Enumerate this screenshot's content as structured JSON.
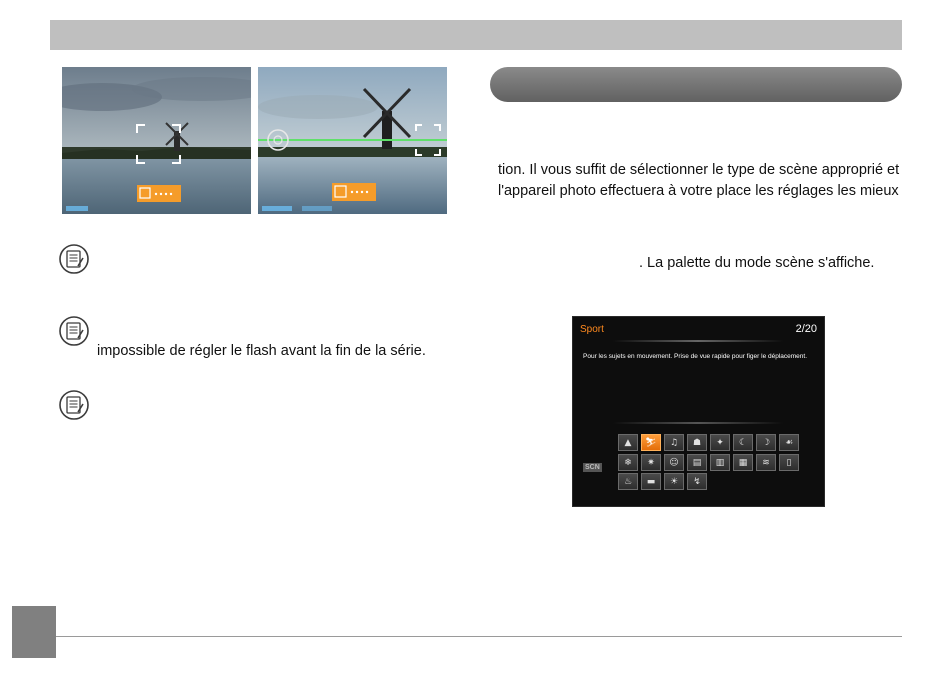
{
  "right_column": {
    "para1_line1": "tion. Il vous suffit de sélectionner le type de scène approprié et",
    "para1_line2": "l'appareil photo effectuera à votre place les réglages les mieux",
    "para2": ". La palette du mode scène s'affiche."
  },
  "notes": {
    "note2_text": "impossible de régler le flash avant la fin de la série."
  },
  "camera_screen": {
    "title": "Sport",
    "page": "2/20",
    "description": "Pour les sujets en mouvement. Prise de vue rapide pour figer le déplacement.",
    "scn_label": "SCN",
    "icon_rows": [
      [
        "landscape-icon",
        "sport-icon",
        "portrait-icon",
        "party-icon",
        "candlelight-icon",
        "night-icon",
        "night-portrait-icon",
        "pet-icon"
      ],
      [
        "snow-icon",
        "fireworks-icon",
        "children-icon",
        "id-icon",
        "glass-icon",
        "frame-icon",
        "panning-icon",
        "document-icon"
      ],
      [
        "food-icon",
        "panorama-icon",
        "sunset-icon",
        "backlight-icon"
      ]
    ],
    "icon_glyphs": [
      [
        "▲",
        "⛷",
        "♫",
        "☗",
        "✦",
        "☾",
        "☽",
        "☙"
      ],
      [
        "❄",
        "✷",
        "☺",
        "▤",
        "▥",
        "▦",
        "≋",
        "▯"
      ],
      [
        "♨",
        "▬",
        "☀",
        "↯"
      ]
    ],
    "selected_index": 1,
    "accent_color": "#ff8a1f"
  }
}
